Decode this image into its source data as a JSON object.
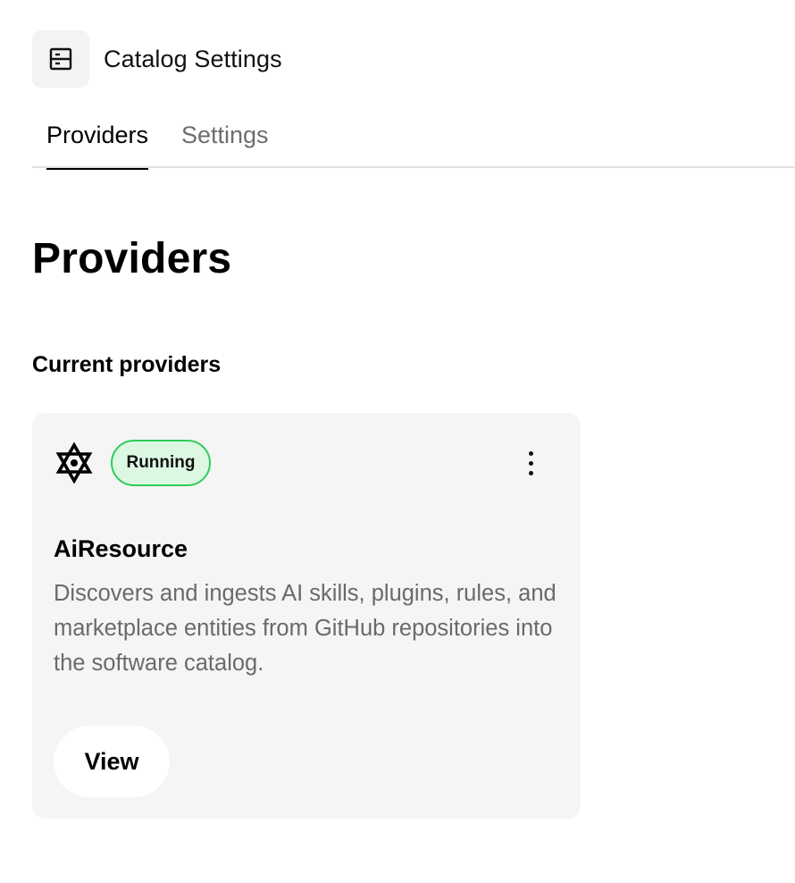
{
  "header": {
    "icon": "catalog-icon",
    "title": "Catalog Settings"
  },
  "tabs": [
    {
      "label": "Providers",
      "active": true
    },
    {
      "label": "Settings",
      "active": false
    }
  ],
  "page": {
    "heading": "Providers",
    "section_heading": "Current providers"
  },
  "providers": [
    {
      "logo_icon": "star-of-david-icon",
      "status": "Running",
      "status_color": "#2ecc5c",
      "status_bg": "#dcf8e3",
      "menu_icon": "more-vertical-icon",
      "name": "AiResource",
      "description": "Discovers and ingests AI skills, plugins, rules, and marketplace entities from GitHub repositories into the software catalog.",
      "action_label": "View"
    }
  ]
}
